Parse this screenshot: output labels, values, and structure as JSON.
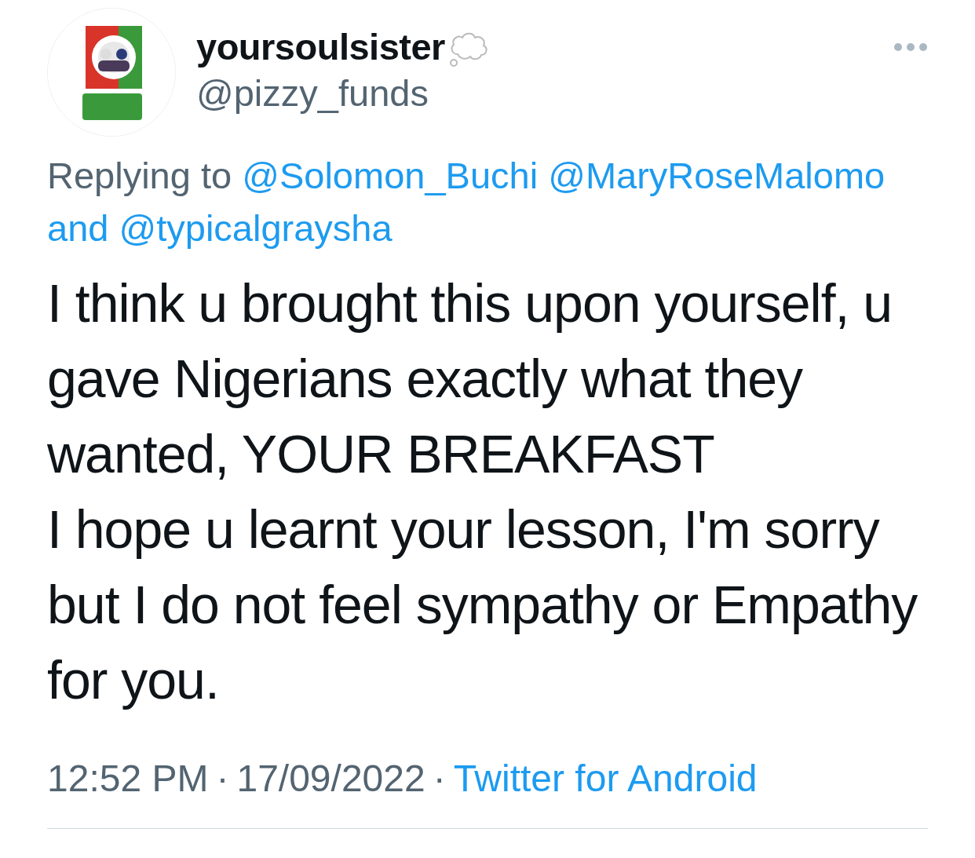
{
  "author": {
    "display_name": "yoursoulsister",
    "handle": "@pizzy_funds"
  },
  "reply": {
    "prefix": "Replying to",
    "mentions": [
      "@Solomon_Buchi",
      "@MaryRoseMalomo"
    ],
    "joiner": "and",
    "last_mention": "@typicalgraysha"
  },
  "body": "I think u brought this upon yourself, u gave Nigerians exactly what they wanted, YOUR BREAKFAST\nI hope u learnt your lesson, I'm sorry but I do not feel sympathy or Empathy for you.",
  "footer": {
    "time": "12:52 PM",
    "separator": "·",
    "date": "17/09/2022",
    "source": "Twitter for Android"
  }
}
